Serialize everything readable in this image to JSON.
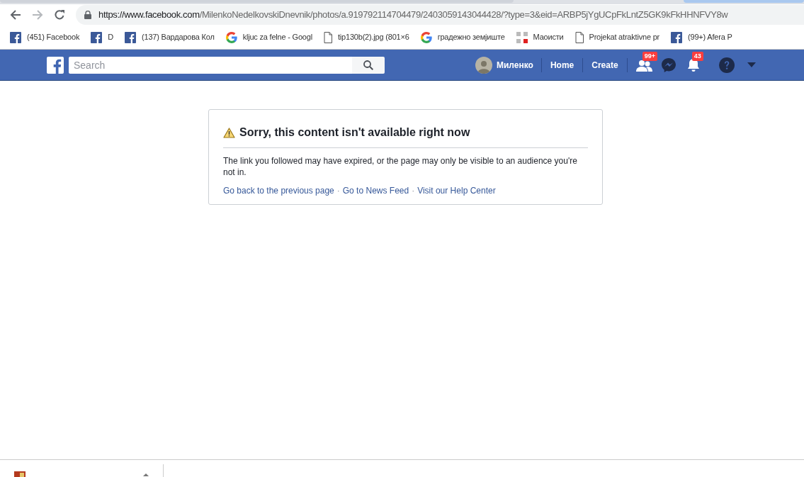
{
  "browser": {
    "url_host": "https://www.facebook.com",
    "url_path": "/MilenkoNedelkovskiDnevnik/photos/a.919792114704479/2403059143044428/?type=3&eid=ARBP5jYgUCpFkLntZ5GK9kFkHHNFVY8w",
    "bookmarks": [
      {
        "kind": "facebook",
        "label": "(451) Facebook"
      },
      {
        "kind": "facebook",
        "label": "D"
      },
      {
        "kind": "facebook",
        "label": "(137) Вардарова Кол"
      },
      {
        "kind": "google",
        "label": "kljuc za felne - Googl"
      },
      {
        "kind": "page",
        "label": "tip130b(2).jpg (801×6"
      },
      {
        "kind": "google",
        "label": "градежно земјиште"
      },
      {
        "kind": "apps",
        "label": "Маоисти"
      },
      {
        "kind": "page",
        "label": "Projekat atraktivne pr"
      },
      {
        "kind": "facebook",
        "label": "(99+) Afera P"
      }
    ]
  },
  "topbar": {
    "search": {
      "placeholder": "Search"
    },
    "profile_name": "Миленко",
    "nav": [
      "Home",
      "Create"
    ],
    "icons": [
      {
        "kind": "friends",
        "badge": "99+"
      },
      {
        "kind": "messenger"
      },
      {
        "kind": "notifications",
        "badge": "43"
      },
      {
        "kind": "help"
      },
      {
        "kind": "menu"
      }
    ]
  },
  "message": {
    "title": "Sorry, this content isn't available right now",
    "body": "The link you followed may have expired, or the page may only be visible to an audience you're not in.",
    "links": [
      "Go back to the previous page",
      "Go to News Feed",
      "Visit our Help Center"
    ],
    "separator": "·"
  }
}
